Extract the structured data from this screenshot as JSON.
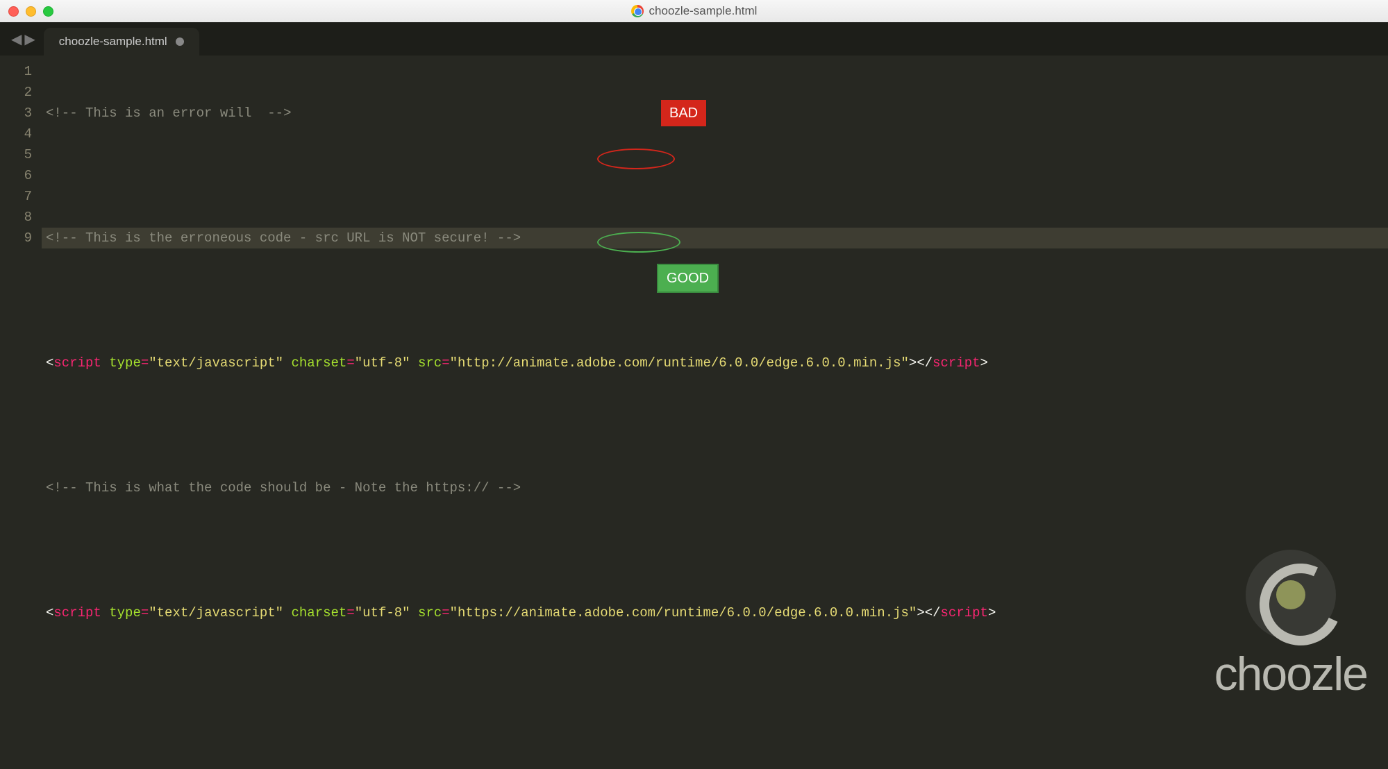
{
  "window": {
    "title": "choozle-sample.html"
  },
  "tab": {
    "label": "choozle-sample.html"
  },
  "gutter": [
    "1",
    "2",
    "3",
    "4",
    "5",
    "6",
    "7",
    "8",
    "9"
  ],
  "annotations": {
    "bad": "BAD",
    "good": "GOOD"
  },
  "code": {
    "l1": {
      "open": "<!--",
      "text": " This is an error will  ",
      "close": "-->"
    },
    "l3": {
      "open": "<!--",
      "text": " This is the erroneous code - src URL is NOT secure! ",
      "close": "-->"
    },
    "l5": {
      "lt1": "<",
      "tag1": "script",
      "attr_type": "type",
      "eq": "=",
      "val_type": "\"text/javascript\"",
      "attr_charset": "charset",
      "val_charset": "\"utf-8\"",
      "attr_src": "src",
      "val_src": "\"http://animate.adobe.com/runtime/6.0.0/edge.6.0.0.min.js\"",
      "gt1": ">",
      "lt2": "</",
      "tag2": "script",
      "gt2": ">"
    },
    "l7": {
      "open": "<!--",
      "text": " This is what the code should be - Note the https:// ",
      "close": "-->"
    },
    "l9": {
      "lt1": "<",
      "tag1": "script",
      "attr_type": "type",
      "eq": "=",
      "val_type": "\"text/javascript\"",
      "attr_charset": "charset",
      "val_charset": "\"utf-8\"",
      "attr_src": "src",
      "val_src": "\"https://animate.adobe.com/runtime/6.0.0/edge.6.0.0.min.js\"",
      "gt1": ">",
      "lt2": "</",
      "tag2": "script",
      "gt2": ">"
    }
  },
  "watermark": {
    "brand": "choozle"
  }
}
